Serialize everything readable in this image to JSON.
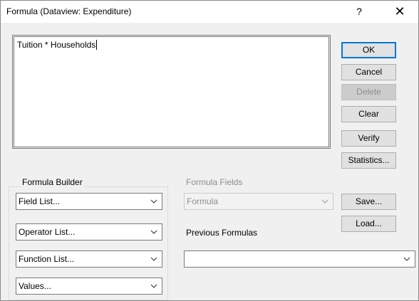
{
  "window": {
    "title": "Formula (Dataview: Expenditure)",
    "help_glyph": "?",
    "close_glyph": "✕"
  },
  "editor": {
    "value": "Tuition * Households"
  },
  "buttons": {
    "ok": "OK",
    "cancel": "Cancel",
    "delete": "Delete",
    "clear": "Clear",
    "verify": "Verify",
    "statistics": "Statistics...",
    "save": "Save...",
    "load": "Load..."
  },
  "formula_builder": {
    "label": "Formula Builder",
    "field_list": "Field List...",
    "operator_list": "Operator List...",
    "function_list": "Function List...",
    "values": "Values..."
  },
  "formula_fields": {
    "label": "Formula Fields",
    "selected": "Formula"
  },
  "previous_formulas": {
    "label": "Previous Formulas",
    "selected": ""
  },
  "icons": {
    "dropdown": "chevron-down-icon",
    "help": "help-icon",
    "close": "close-icon"
  },
  "colors": {
    "dialog_bg": "#f0f0f0",
    "button_bg": "#e1e1e1",
    "default_button_border": "#0078d7",
    "disabled_text": "#8d8d8d"
  }
}
